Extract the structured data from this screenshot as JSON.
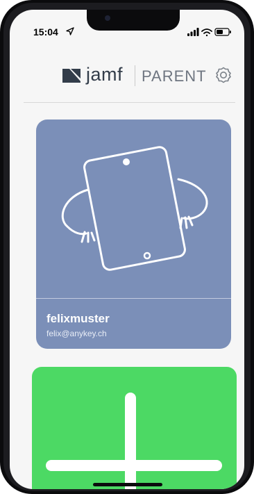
{
  "status_bar": {
    "time": "15:04"
  },
  "header": {
    "brand": "jamf",
    "product": "PARENT"
  },
  "device_card": {
    "username": "felixmuster",
    "email": "felix@anykey.ch"
  },
  "colors": {
    "card_background": "#7b8fb8",
    "add_card_background": "#4cd964",
    "brand_text": "#333d4a"
  },
  "icons": {
    "settings": "gear-icon",
    "add": "plus-icon",
    "device": "tablet-icon"
  }
}
